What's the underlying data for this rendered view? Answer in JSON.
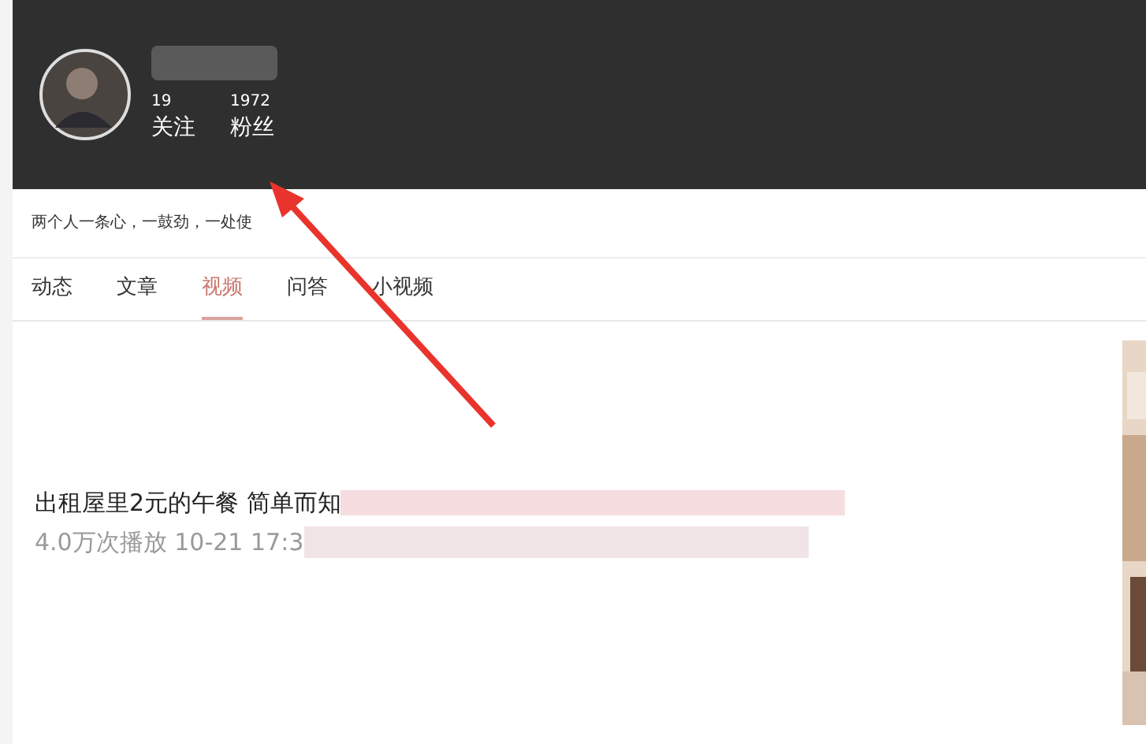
{
  "profile": {
    "following_count": "19",
    "following_label": "关注",
    "followers_count": "1972",
    "followers_label": "粉丝",
    "bio": "两个人一条心，一鼓劲，一处使"
  },
  "tabs": [
    {
      "label": "动态",
      "selected": false
    },
    {
      "label": "文章",
      "selected": false
    },
    {
      "label": "视频",
      "selected": true
    },
    {
      "label": "问答",
      "selected": false
    },
    {
      "label": "小视频",
      "selected": false
    }
  ],
  "video": {
    "title": "出租屋里2元的午餐 简单而知",
    "meta": "4.0万次播放 10-21 17:3"
  }
}
